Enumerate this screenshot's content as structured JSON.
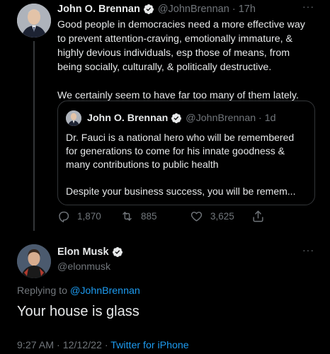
{
  "tweet1": {
    "name": "John O. Brennan",
    "handle": "@JohnBrennan",
    "time": "17h",
    "more": "···",
    "lines": [
      "Good people in democracies need a more effective way",
      "to prevent attention-craving, emotionally immature, &",
      "highly devious individuals, esp those of means, from",
      "being socially, culturally, & politically destructive."
    ],
    "line2": "We certainly seem to have far too many of them lately.",
    "quote": {
      "name": "John O. Brennan",
      "handle": "@JohnBrennan",
      "time": "1d",
      "lines": [
        "Dr. Fauci is a national hero who will be remembered",
        "for generations to come for his innate goodness &",
        "many contributions to public health"
      ],
      "line2": "Despite your business success, you will be remem..."
    },
    "stats": {
      "replies": "1,870",
      "retweets": "885",
      "likes": "3,625"
    }
  },
  "tweet2": {
    "name": "Elon Musk",
    "handle": "@elonmusk",
    "more": "···",
    "replying_prefix": "Replying to",
    "replying_handle": "@JohnBrennan",
    "text": "Your house is glass",
    "time": "9:27 AM",
    "date": "12/12/22",
    "source": "Twitter for iPhone"
  },
  "icons": {
    "verified": "verified-badge-icon",
    "reply": "reply-icon",
    "retweet": "retweet-icon",
    "like": "heart-icon",
    "share": "share-icon",
    "more": "more-dots-icon"
  },
  "colors": {
    "background": "#000000",
    "text": "#e7e9ea",
    "muted": "#71767b",
    "accent": "#1d9bf0",
    "border": "#333639"
  }
}
